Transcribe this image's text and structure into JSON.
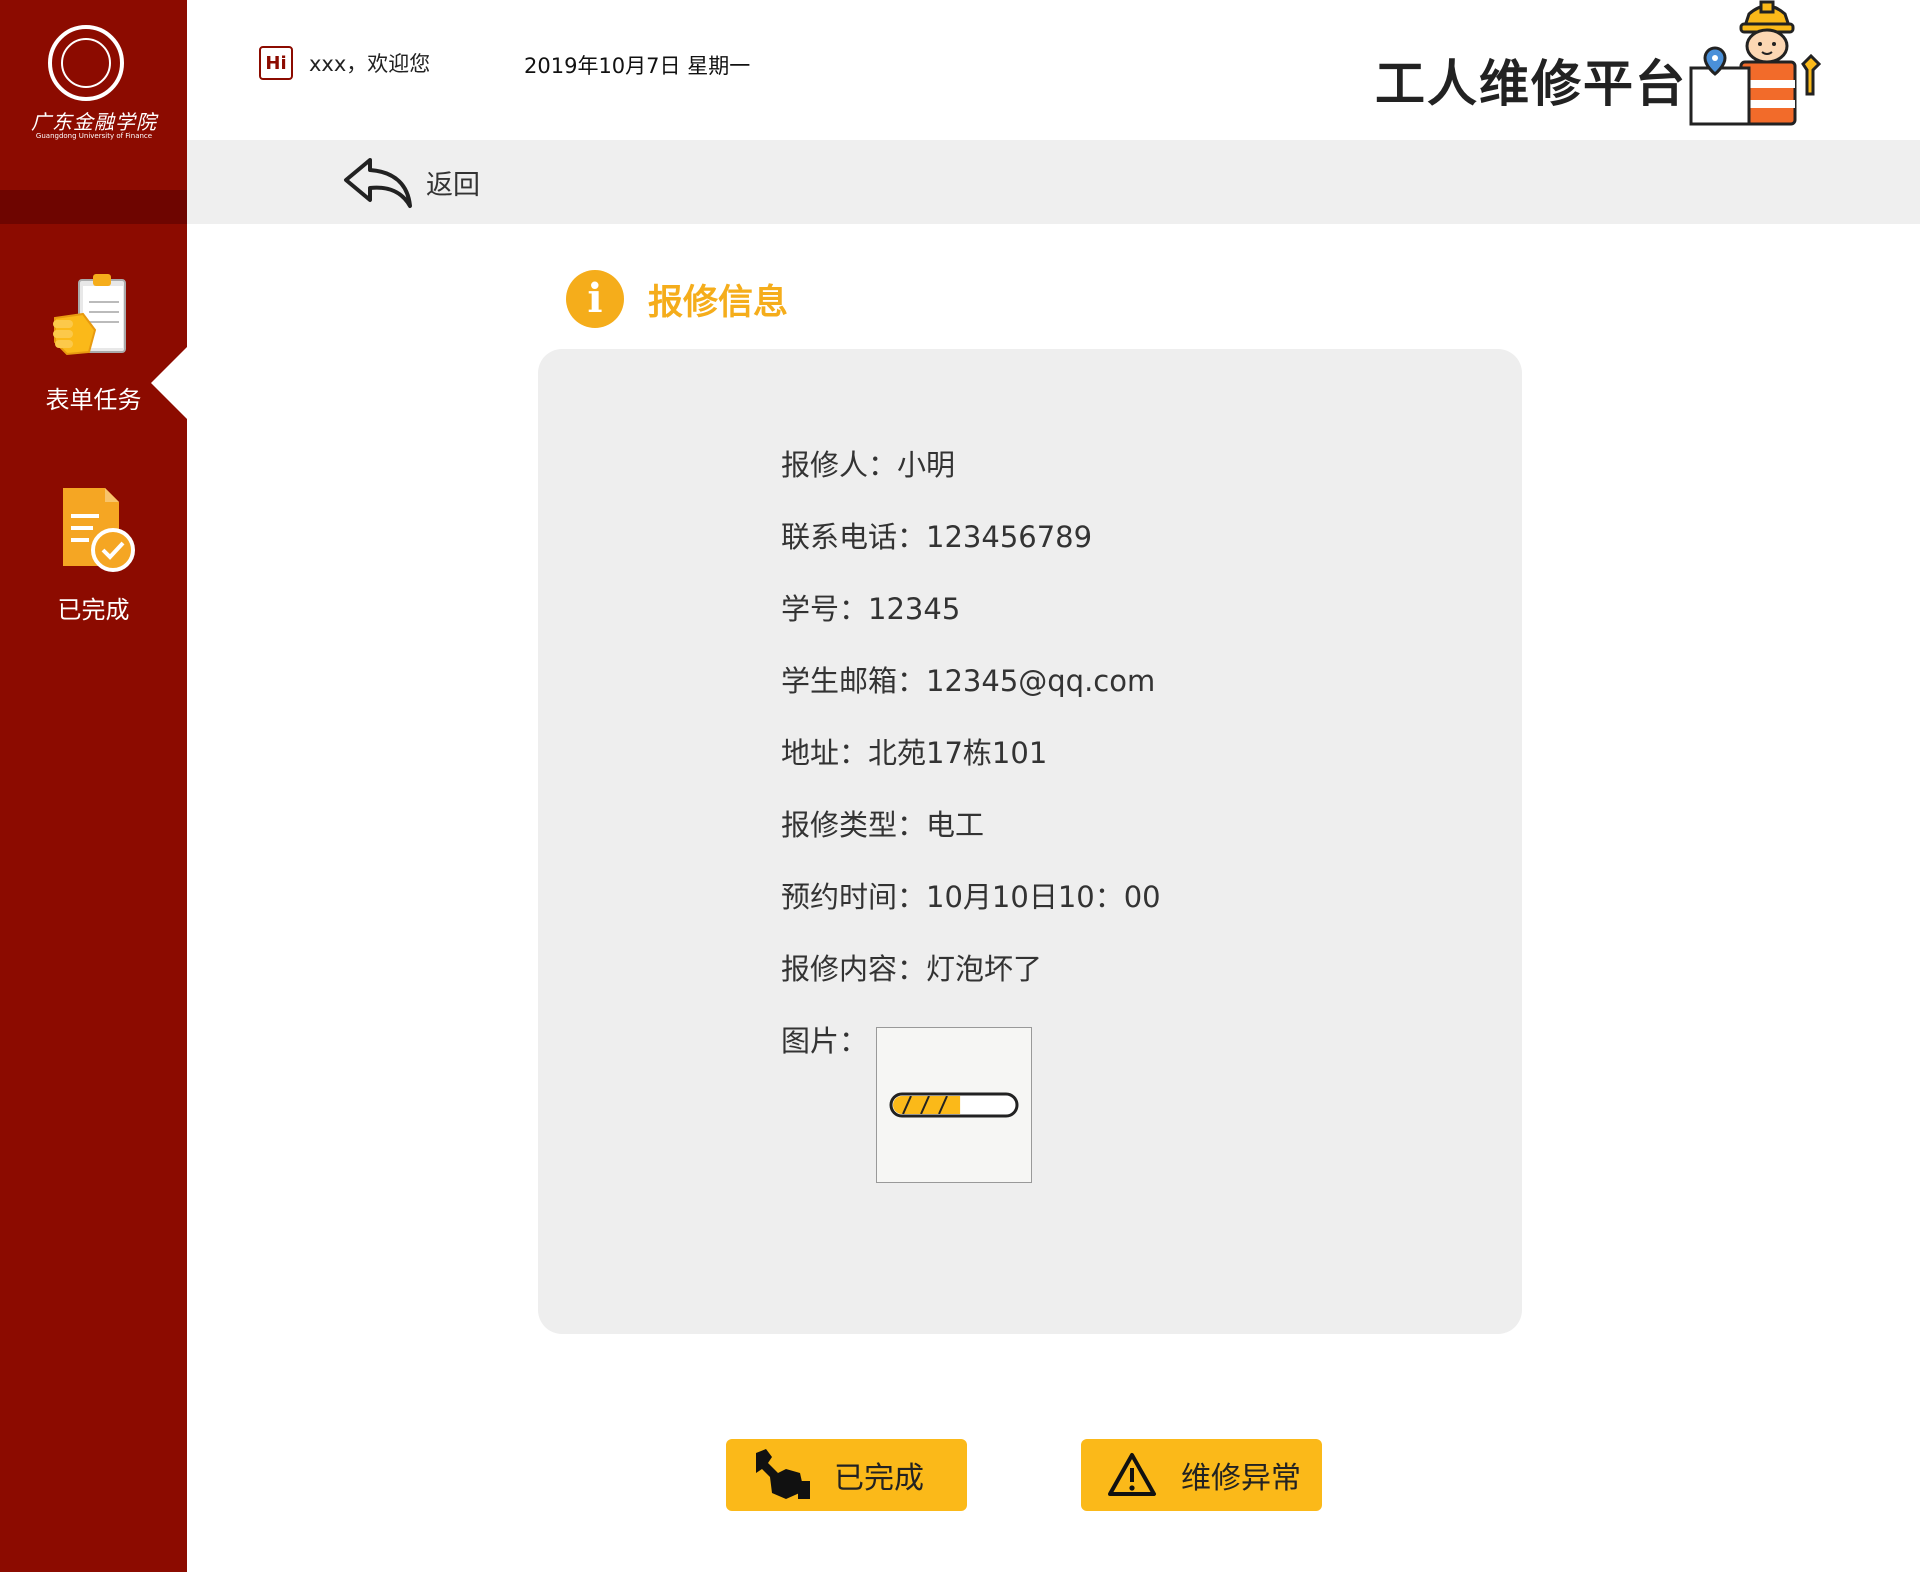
{
  "sidebar": {
    "logo_cn": "广东金融学院",
    "logo_en": "Guangdong University of Finance",
    "items": [
      {
        "label": "表单任务",
        "icon": "clipboard-hand-icon",
        "active": true
      },
      {
        "label": "已完成",
        "icon": "document-check-icon",
        "active": false
      }
    ]
  },
  "header": {
    "hi_badge": "Hi",
    "welcome": "xxx，欢迎您",
    "date": "2019年10月7日 星期一",
    "title": "工人维修平台"
  },
  "backbar": {
    "back_label": "返回"
  },
  "section": {
    "title": "报修信息",
    "icon": "info-icon"
  },
  "fields": [
    {
      "key": "报修人：",
      "value": "小明"
    },
    {
      "key": "联系电话：",
      "value": "123456789"
    },
    {
      "key": "学号：",
      "value": "12345"
    },
    {
      "key": "学生邮箱：",
      "value": "12345@qq.com"
    },
    {
      "key": "地址：",
      "value": "北苑17栋101"
    },
    {
      "key": "报修类型：",
      "value": "电工"
    },
    {
      "key": "预约时间：",
      "value": "10月10日10：00"
    },
    {
      "key": "报修内容：",
      "value": "灯泡坏了"
    }
  ],
  "photo": {
    "label": "图片：",
    "loading_progress": 0.55
  },
  "actions": {
    "done_label": "已完成",
    "abnormal_label": "维修异常"
  },
  "colors": {
    "sidebar_bg": "#8c0b00",
    "accent": "#f5ad1b",
    "button": "#fbb919"
  }
}
